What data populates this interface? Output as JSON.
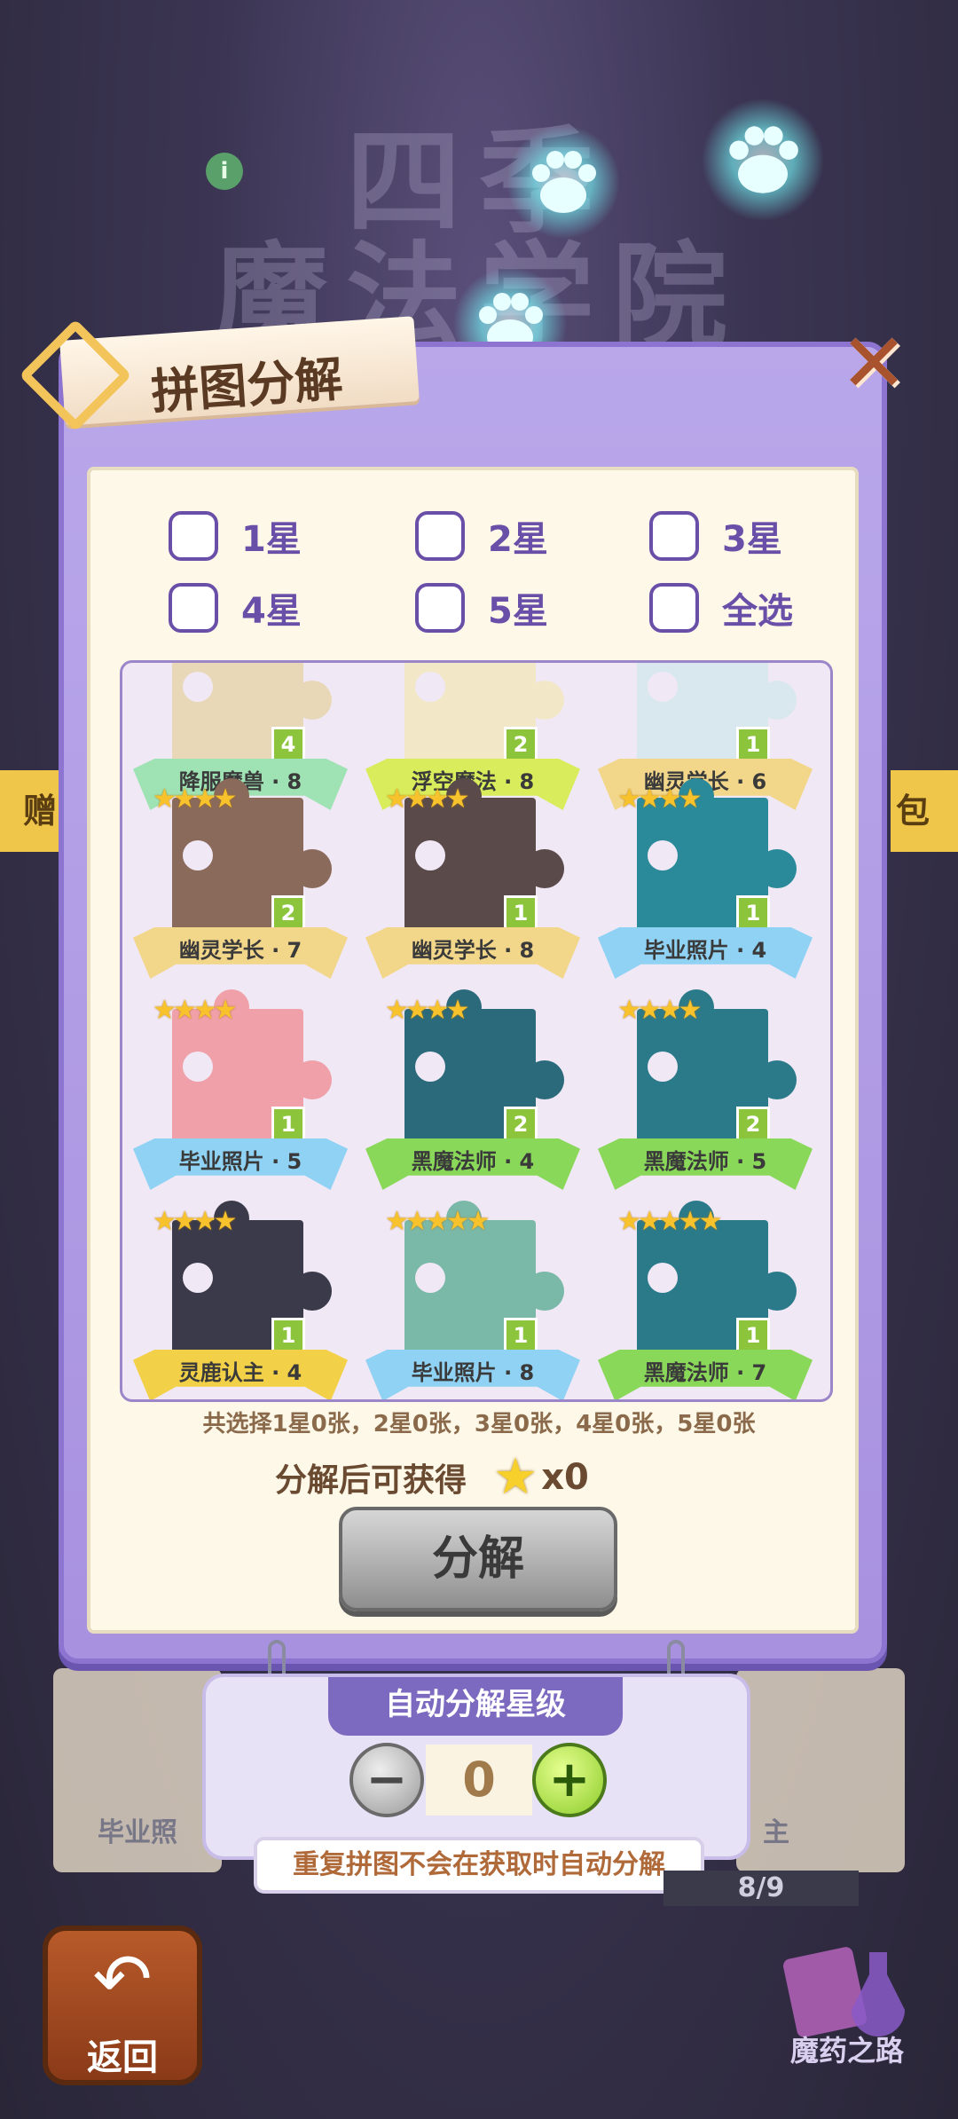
{
  "background": {
    "title_line1": "四季",
    "title_line2": "魔法学院",
    "left_ribbon": "赠",
    "right_ribbon": "包"
  },
  "info_icon": "i",
  "panel": {
    "title": "拼图分解",
    "close": "✕",
    "filters": [
      {
        "label": "1星",
        "checked": false
      },
      {
        "label": "2星",
        "checked": false
      },
      {
        "label": "3星",
        "checked": false
      },
      {
        "label": "4星",
        "checked": false
      },
      {
        "label": "5星",
        "checked": false
      },
      {
        "label": "全选",
        "checked": false
      }
    ],
    "pieces": [
      {
        "name": "降服魔兽 · 8",
        "count": "4",
        "stars": "",
        "ribbon": "#9fe3b4",
        "pic": "#e8d8b8"
      },
      {
        "name": "浮空魔法 · 8",
        "count": "2",
        "stars": "",
        "ribbon": "#d8ec5c",
        "pic": "#f2e8c8"
      },
      {
        "name": "幽灵学长 · 6",
        "count": "1",
        "stars": "",
        "ribbon": "#f2d68a",
        "pic": "#d8e8ee"
      },
      {
        "name": "幽灵学长 · 7",
        "count": "2",
        "stars": "★★★★",
        "ribbon": "#f2d68a",
        "pic": "#8a6a5a"
      },
      {
        "name": "幽灵学长 · 8",
        "count": "1",
        "stars": "★★★★",
        "ribbon": "#f2d68a",
        "pic": "#5a4a4a"
      },
      {
        "name": "毕业照片 · 4",
        "count": "1",
        "stars": "★★★★",
        "ribbon": "#8fd2f4",
        "pic": "#2a8a9a"
      },
      {
        "name": "毕业照片 · 5",
        "count": "1",
        "stars": "★★★★",
        "ribbon": "#8fd2f4",
        "pic": "#f0a0a8"
      },
      {
        "name": "黑魔法师 · 4",
        "count": "2",
        "stars": "★★★★",
        "ribbon": "#8ad85a",
        "pic": "#2a6a7a"
      },
      {
        "name": "黑魔法师 · 5",
        "count": "2",
        "stars": "★★★★",
        "ribbon": "#8ad85a",
        "pic": "#2a7a8a"
      },
      {
        "name": "灵鹿认主 · 4",
        "count": "1",
        "stars": "★★★★",
        "ribbon": "#f2d048",
        "pic": "#3a3a4a"
      },
      {
        "name": "毕业照片 · 8",
        "count": "1",
        "stars": "★★★★★",
        "ribbon": "#8fd2f4",
        "pic": "#7ab8a8"
      },
      {
        "name": "黑魔法师 · 7",
        "count": "1",
        "stars": "★★★★★",
        "ribbon": "#8ad85a",
        "pic": "#2a7a8a"
      }
    ],
    "summary": "共选择1星0张，2星0张，3星0张，4星0张，5星0张",
    "gain_label": "分解后可获得",
    "gain_value": "x0",
    "decompose_button": "分解"
  },
  "auto": {
    "title": "自动分解星级",
    "minus": "−",
    "plus": "+",
    "level": "0",
    "hint": "重复拼图不会在获取时自动分解"
  },
  "bottom": {
    "progress": "8/9",
    "back_label": "返回",
    "road_label": "魔药之路",
    "under_left": "毕业照",
    "under_right": "主"
  }
}
